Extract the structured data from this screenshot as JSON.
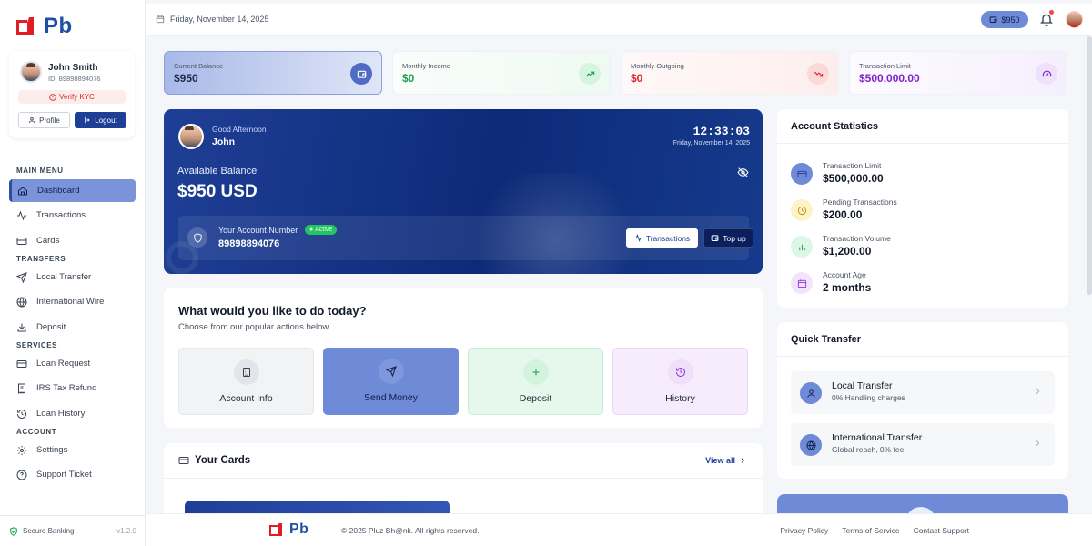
{
  "brand": {
    "name": "Pb",
    "primary": "#1e3f96",
    "accent": "#e11d24"
  },
  "sidebar": {
    "user": {
      "name": "John Smith",
      "id": "ID: 89898894076",
      "kyc_label": "Verify KYC",
      "profile_label": "Profile",
      "logout_label": "Logout"
    },
    "sections": {
      "main": "MAIN MENU",
      "transfers": "TRANSFERS",
      "services": "SERVICES",
      "account": "ACCOUNT"
    },
    "items": {
      "dashboard": "Dashboard",
      "transactions": "Transactions",
      "cards": "Cards",
      "local_transfer": "Local Transfer",
      "international_wire": "International Wire",
      "deposit": "Deposit",
      "loan_request": "Loan Request",
      "irs_tax_refund": "IRS Tax Refund",
      "loan_history": "Loan History",
      "settings": "Settings",
      "support_ticket": "Support Ticket"
    },
    "footer": {
      "secure": "Secure Banking",
      "version": "v1.2.0"
    }
  },
  "topbar": {
    "date": "Friday, November 14, 2025",
    "balance": "$950"
  },
  "stats": [
    {
      "label": "Current Balance",
      "value": "$950"
    },
    {
      "label": "Monthly Income",
      "value": "$0"
    },
    {
      "label": "Monthly Outgoing",
      "value": "$0"
    },
    {
      "label": "Transaction Limit",
      "value": "$500,000.00"
    }
  ],
  "hero": {
    "greeting": "Good Afternoon",
    "name": "John",
    "time": "12:33:03",
    "date": "Friday, November 14, 2025",
    "available_label": "Available Balance",
    "available_value": "$950 USD",
    "account_label": "Your Account Number",
    "status": "Active",
    "account_number": "89898894076",
    "transactions_btn": "Transactions",
    "topup_btn": "Top up"
  },
  "actions": {
    "title": "What would you like to do today?",
    "subtitle": "Choose from our popular actions below",
    "items": [
      "Account Info",
      "Send Money",
      "Deposit",
      "History"
    ]
  },
  "cards_section": {
    "title": "Your Cards",
    "view_all": "View all"
  },
  "account_statistics": {
    "title": "Account Statistics",
    "rows": [
      {
        "label": "Transaction Limit",
        "value": "$500,000.00"
      },
      {
        "label": "Pending Transactions",
        "value": "$200.00"
      },
      {
        "label": "Transaction Volume",
        "value": "$1,200.00"
      },
      {
        "label": "Account Age",
        "value": "2 months"
      }
    ]
  },
  "quick_transfer": {
    "title": "Quick Transfer",
    "items": [
      {
        "name": "Local Transfer",
        "sub": "0% Handling charges"
      },
      {
        "name": "International Transfer",
        "sub": "Global reach, 0% fee"
      }
    ]
  },
  "footer": {
    "copyright": "© 2025 Pluz Bh@nk. All rights reserved.",
    "links": [
      "Privacy Policy",
      "Terms of Service",
      "Contact Support"
    ]
  }
}
